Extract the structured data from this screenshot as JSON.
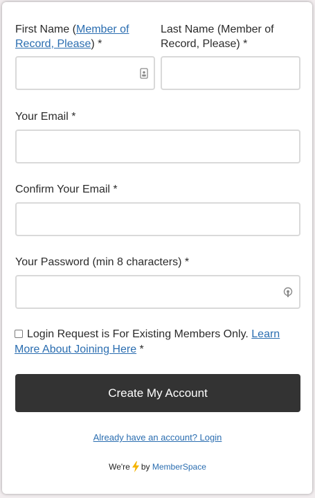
{
  "form": {
    "first_name": {
      "label_prefix": "First Name (",
      "label_link": "Member of Record, Please",
      "label_suffix": ") *",
      "value": "",
      "icon": "contact-card-icon"
    },
    "last_name": {
      "label": "Last Name (Member of Record, Please) *",
      "value": ""
    },
    "email": {
      "label": "Your Email *",
      "value": ""
    },
    "confirm_email": {
      "label": "Confirm Your Email *",
      "value": ""
    },
    "password": {
      "label": "Your Password (min 8 characters) *",
      "value": "",
      "icon": "password-manager-icon"
    },
    "terms": {
      "checked": false,
      "text": "Login Request is For Existing Members Only. ",
      "link": "Learn More About Joining Here",
      "suffix": " *"
    },
    "submit_label": "Create My Account",
    "login_link": "Already have an account? Login"
  },
  "footer": {
    "prefix": "We're",
    "by": "by",
    "brand": "MemberSpace",
    "bolt_color": "#f5b400"
  },
  "colors": {
    "accent_link": "#2a6db0",
    "button_bg": "#333333",
    "field_border": "#d9d9d9"
  }
}
